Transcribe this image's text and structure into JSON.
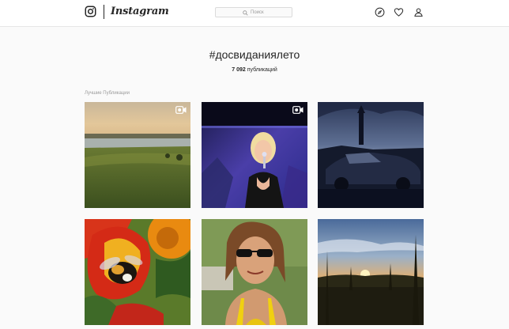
{
  "header": {
    "brand": "Instagram",
    "logo_icon": "instagram-camera-icon",
    "search": {
      "placeholder": "Поиск",
      "icon": "search-icon"
    },
    "nav_icons": [
      "compass-explore-icon",
      "heart-activity-icon",
      "person-profile-icon"
    ]
  },
  "hashtag": {
    "title": "#досвиданиялето",
    "count_number": "7 092",
    "count_label": "публикаций"
  },
  "top_posts": {
    "section_label": "Лучшие Публикации",
    "posts": [
      {
        "id": "post-1",
        "subject": "sunset over lake and field",
        "video": true
      },
      {
        "id": "post-2",
        "subject": "singer with microphone on stage",
        "video": true
      },
      {
        "id": "post-3",
        "subject": "dark sky over car and tower",
        "video": false
      },
      {
        "id": "post-4",
        "subject": "bumblebee on orange flower",
        "video": false
      },
      {
        "id": "post-5",
        "subject": "woman in sunglasses selfie",
        "video": false
      },
      {
        "id": "post-6",
        "subject": "sunset over meadow",
        "video": false
      }
    ]
  },
  "colors": {
    "background": "#fafafa",
    "text": "#262626",
    "muted": "#999999",
    "border": "#dbdbdb"
  }
}
